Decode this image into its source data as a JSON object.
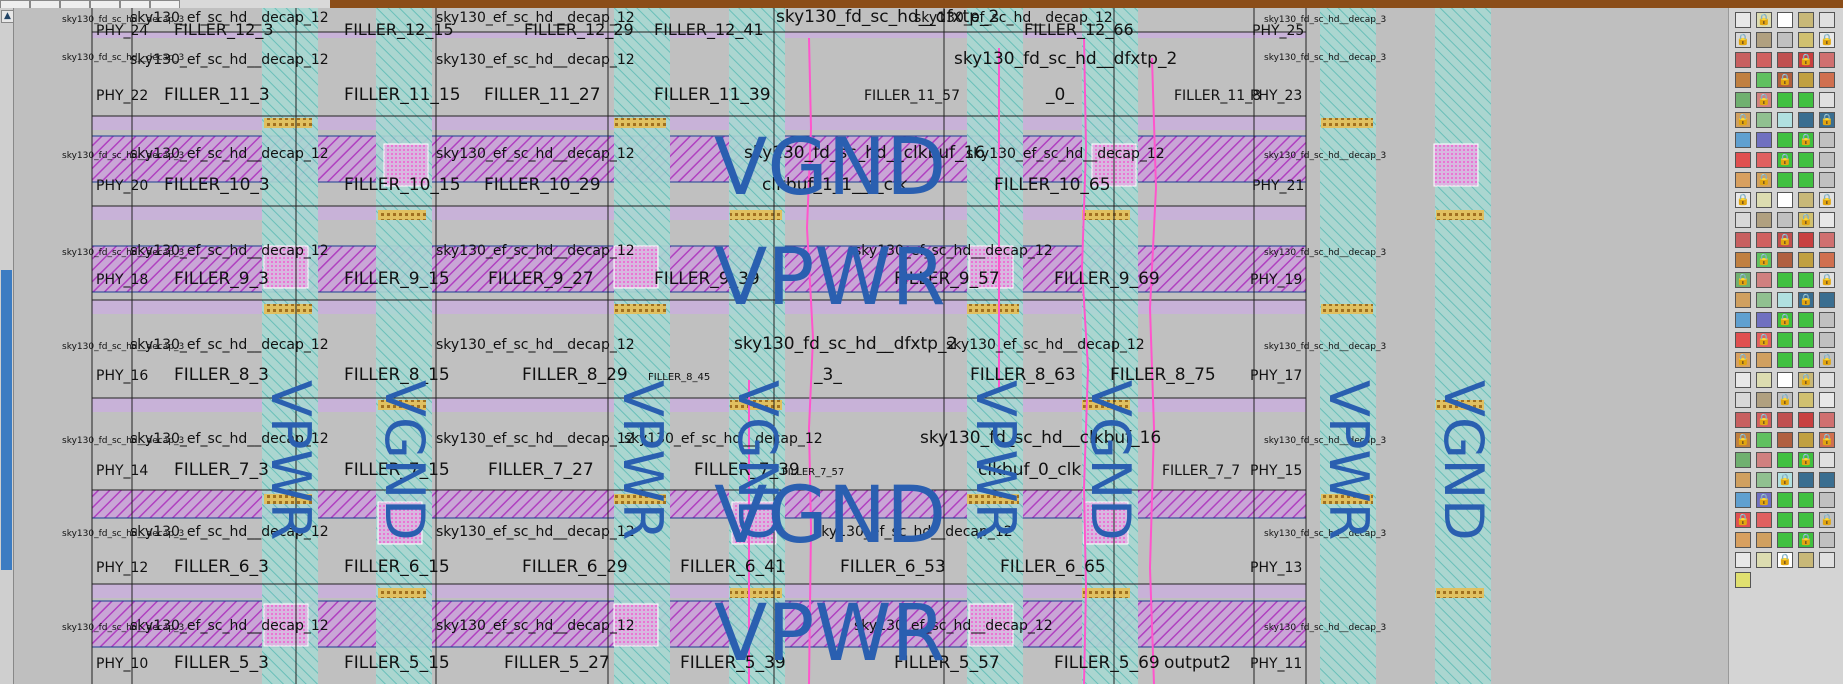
{
  "canvas_labels": {
    "r12a": "sky130_fd_sc_hd__dfxtp_2",
    "r12b": "sky130_ef_sc_hd__decap_12",
    "r12c": "FILLER_12_3",
    "r12d": "FILLER_12_15",
    "r12e": "FILLER_12_29",
    "r12f": "FILLER_12_41",
    "r12g": "FILLER_12_66",
    "r12h": "PHY_24",
    "r12i": "PHY_25",
    "r11a": "FILLER_11_3",
    "r11b": "FILLER_11_15",
    "r11c": "FILLER_11_27",
    "r11d": "FILLER_11_39",
    "r11e": "FILLER_11_57",
    "r11f": "_0_",
    "r11g": "FILLER_11_8",
    "r11h": "PHY_22",
    "r11i": "PHY_23",
    "r11j": "sky130_fd_sc_hd__dfxtp_2",
    "r10a": "FILLER_10_3",
    "r10b": "FILLER_10_15",
    "r10c": "FILLER_10_29",
    "r10d": "clkbuf_1_1__f_clk",
    "r10e": "FILLER_10_65",
    "r10f": "sky130_fd_sc_hd__clkbuf_16",
    "r10g": "PHY_20",
    "r10h": "PHY_21",
    "r9a": "FILLER_9_3",
    "r9b": "FILLER_9_15",
    "r9c": "FILLER_9_27",
    "r9d": "FILLER_9_39",
    "r9e": "FILLER_9_57",
    "r9f": "FILLER_9_69",
    "r9g": "PHY_18",
    "r9h": "PHY_19",
    "r8a": "FILLER_8_3",
    "r8b": "FILLER_8_15",
    "r8c": "FILLER_8_29",
    "r8d": "_3_",
    "r8e": "FILLER_8_63",
    "r8f": "FILLER_8_75",
    "r8g": "sky130_fd_sc_hd__dfxtp_2",
    "r8h": "PHY_16",
    "r8i": "PHY_17",
    "r8j": "FILLER_8_45",
    "r7a": "FILLER_7_3",
    "r7b": "FILLER_7_15",
    "r7c": "FILLER_7_27",
    "r7d": "FILLER_7_39",
    "r7e": "clkbuf_0_clk",
    "r7f": "FILLER_7_7",
    "r7g": "sky130_fd_sc_hd__clkbuf_16",
    "r7h": "PHY_14",
    "r7i": "PHY_15",
    "r7j": "FILLER_7_57",
    "r6a": "FILLER_6_3",
    "r6b": "FILLER_6_15",
    "r6c": "FILLER_6_29",
    "r6d": "FILLER_6_41",
    "r6e": "FILLER_6_53",
    "r6f": "FILLER_6_65",
    "r6g": "PHY_12",
    "r6h": "PHY_13",
    "r5a": "FILLER_5_3",
    "r5b": "FILLER_5_15",
    "r5c": "FILLER_5_27",
    "r5d": "FILLER_5_39",
    "r5e": "FILLER_5_57",
    "r5f": "FILLER_5_69",
    "r5g": "output2",
    "r5h": "PHY_10",
    "r5i": "PHY_11",
    "small_decap": "sky130_fd_sc_hd__decap_3",
    "small_ef": "sky130_ef_sc_hd__decap_12",
    "vgnd": "VGND",
    "vpwr": "VPWR"
  },
  "colors": {
    "canvas_bg": "#bfbfbf",
    "magenta_stripe": "#c45ac4",
    "cyan_stripe": "#8fd6d0",
    "power_text": "#2a5fb0",
    "orange_bar": "#8b4d18"
  }
}
